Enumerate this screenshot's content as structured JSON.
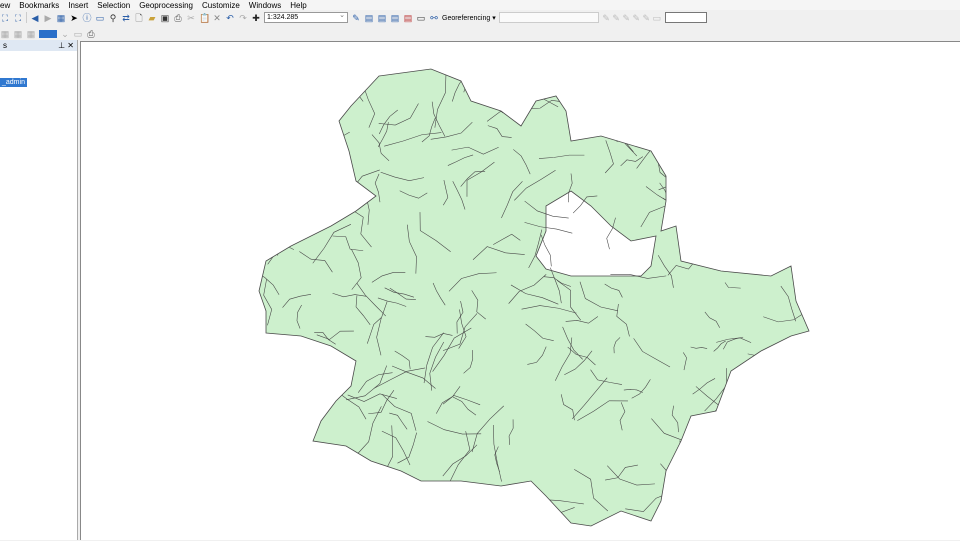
{
  "menu": [
    "ew",
    "Bookmarks",
    "Insert",
    "Selection",
    "Geoprocessing",
    "Customize",
    "Windows",
    "Help"
  ],
  "toolbar": {
    "scale": "1:324.285",
    "georeferencing": "Georeferencing ▾"
  },
  "toc": {
    "title": "s",
    "layer": "_admin"
  },
  "map": {
    "fill": "#cdf0cd",
    "stroke": "#4a4a4a"
  }
}
